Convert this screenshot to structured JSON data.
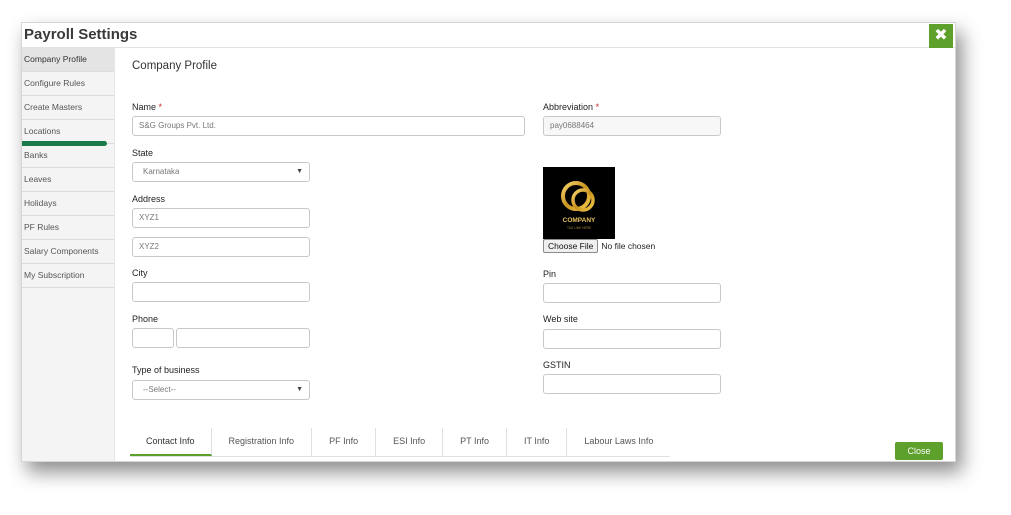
{
  "window": {
    "title": "Payroll Settings"
  },
  "sidebar": {
    "items": [
      {
        "label": "Company Profile"
      },
      {
        "label": "Configure Rules"
      },
      {
        "label": "Create Masters"
      },
      {
        "label": "Locations"
      },
      {
        "label": "Banks"
      },
      {
        "label": "Leaves"
      },
      {
        "label": "Holidays"
      },
      {
        "label": "PF Rules"
      },
      {
        "label": "Salary Components"
      },
      {
        "label": "My Subscription"
      }
    ]
  },
  "form": {
    "section_title": "Company Profile",
    "name": {
      "label": "Name",
      "required_mark": "*",
      "value": "S&G Groups Pvt. Ltd."
    },
    "abbreviation": {
      "label": "Abbreviation",
      "required_mark": "*",
      "value": "pay0688464"
    },
    "state": {
      "label": "State",
      "value": "Karnataka"
    },
    "address": {
      "label": "Address",
      "line1": "XYZ1",
      "line2": "XYZ2"
    },
    "city": {
      "label": "City",
      "value": ""
    },
    "pin": {
      "label": "Pin",
      "value": ""
    },
    "phone": {
      "label": "Phone",
      "code": "",
      "number": ""
    },
    "website": {
      "label": "Web site",
      "value": ""
    },
    "type_of_business": {
      "label": "Type of business",
      "value": "--Select--"
    },
    "gstin": {
      "label": "GSTIN",
      "value": ""
    },
    "logo": {
      "text": "COMPANY",
      "subtext": "TAG LINE HERE"
    },
    "file": {
      "button": "Choose File",
      "status": "No file chosen"
    }
  },
  "tabs": [
    {
      "label": "Contact Info"
    },
    {
      "label": "Registration Info"
    },
    {
      "label": "PF Info"
    },
    {
      "label": "ESI Info"
    },
    {
      "label": "PT Info"
    },
    {
      "label": "IT Info"
    },
    {
      "label": "Labour Laws Info"
    }
  ],
  "footer": {
    "close_label": "Close"
  },
  "icons": {
    "close": "close-icon",
    "dropdown": "chevron-down-icon"
  },
  "colors": {
    "accent": "#5da02c",
    "progress": "#1a7a4a"
  }
}
